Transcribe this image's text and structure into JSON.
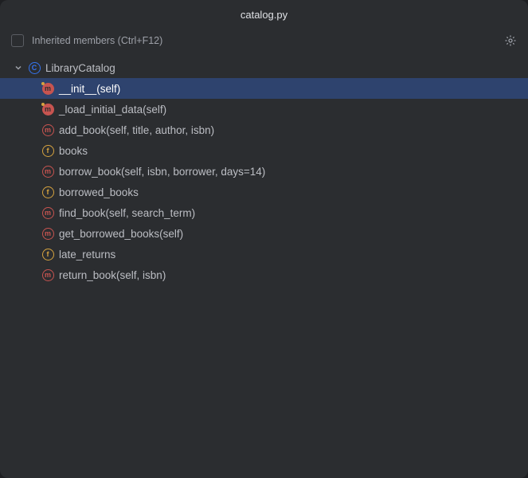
{
  "title": "catalog.py",
  "toolbar": {
    "inherited_label": "Inherited members (Ctrl+F12)"
  },
  "root": {
    "label": "LibraryCatalog",
    "icon_letter": "C"
  },
  "members": [
    {
      "label": "__init__(self)",
      "icon": "filled",
      "letter": "m",
      "selected": true
    },
    {
      "label": "_load_initial_data(self)",
      "icon": "filled",
      "letter": "m",
      "selected": false
    },
    {
      "label": "add_book(self, title, author, isbn)",
      "icon": "method",
      "letter": "m",
      "selected": false
    },
    {
      "label": "books",
      "icon": "field",
      "letter": "f",
      "selected": false
    },
    {
      "label": "borrow_book(self, isbn, borrower, days=14)",
      "icon": "method",
      "letter": "m",
      "selected": false
    },
    {
      "label": "borrowed_books",
      "icon": "field",
      "letter": "f",
      "selected": false
    },
    {
      "label": "find_book(self, search_term)",
      "icon": "method",
      "letter": "m",
      "selected": false
    },
    {
      "label": "get_borrowed_books(self)",
      "icon": "method",
      "letter": "m",
      "selected": false
    },
    {
      "label": "late_returns",
      "icon": "field",
      "letter": "f",
      "selected": false
    },
    {
      "label": "return_book(self, isbn)",
      "icon": "method",
      "letter": "m",
      "selected": false
    }
  ]
}
